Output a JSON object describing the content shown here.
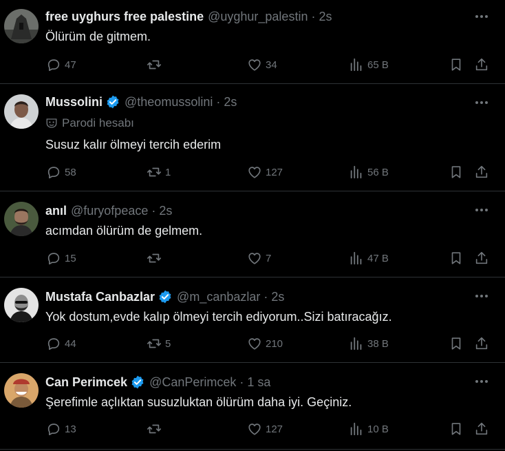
{
  "tweets": [
    {
      "name": "free uyghurs free palestine",
      "verified": false,
      "handle": "@uyghur_palestin",
      "dot": "·",
      "time": "2s",
      "parody": "",
      "text": "Ölürüm de gitmem.",
      "replies": "47",
      "retweets": "",
      "likes": "34",
      "views": "65 B"
    },
    {
      "name": "Mussolini",
      "verified": true,
      "handle": "@theomussolini",
      "dot": "·",
      "time": "2s",
      "parody": "Parodi hesabı",
      "text": "Susuz kalır ölmeyi tercih ederim",
      "replies": "58",
      "retweets": "1",
      "likes": "127",
      "views": "56 B"
    },
    {
      "name": "anıl",
      "verified": false,
      "handle": "@furyofpeace",
      "dot": "·",
      "time": "2s",
      "parody": "",
      "text": "acımdan ölürüm de gelmem.",
      "replies": "15",
      "retweets": "",
      "likes": "7",
      "views": "47 B"
    },
    {
      "name": "Mustafa Canbazlar",
      "verified": true,
      "handle": "@m_canbazlar",
      "dot": "·",
      "time": "2s",
      "parody": "",
      "text": "Yok dostum,evde kalıp ölmeyi tercih ediyorum..Sizi batıracağız.",
      "replies": "44",
      "retweets": "5",
      "likes": "210",
      "views": "38 B"
    },
    {
      "name": "Can Perimcek",
      "verified": true,
      "handle": "@CanPerimcek",
      "dot": "·",
      "time": "1 sa",
      "parody": "",
      "text": "Şerefimle açlıktan susuzluktan ölürüm daha iyi. Geçiniz.",
      "replies": "13",
      "retweets": "",
      "likes": "127",
      "views": "10 B"
    }
  ],
  "colors": {
    "background": "#000000",
    "primary_text": "#e7e9ea",
    "secondary_text": "#71767b",
    "divider": "#2f3336",
    "verified_badge": "#1d9bf0"
  },
  "icons": [
    "reply-icon",
    "retweet-icon",
    "like-icon",
    "views-icon",
    "bookmark-icon",
    "share-icon",
    "more-icon",
    "verified-badge-icon",
    "parody-mask-icon"
  ]
}
